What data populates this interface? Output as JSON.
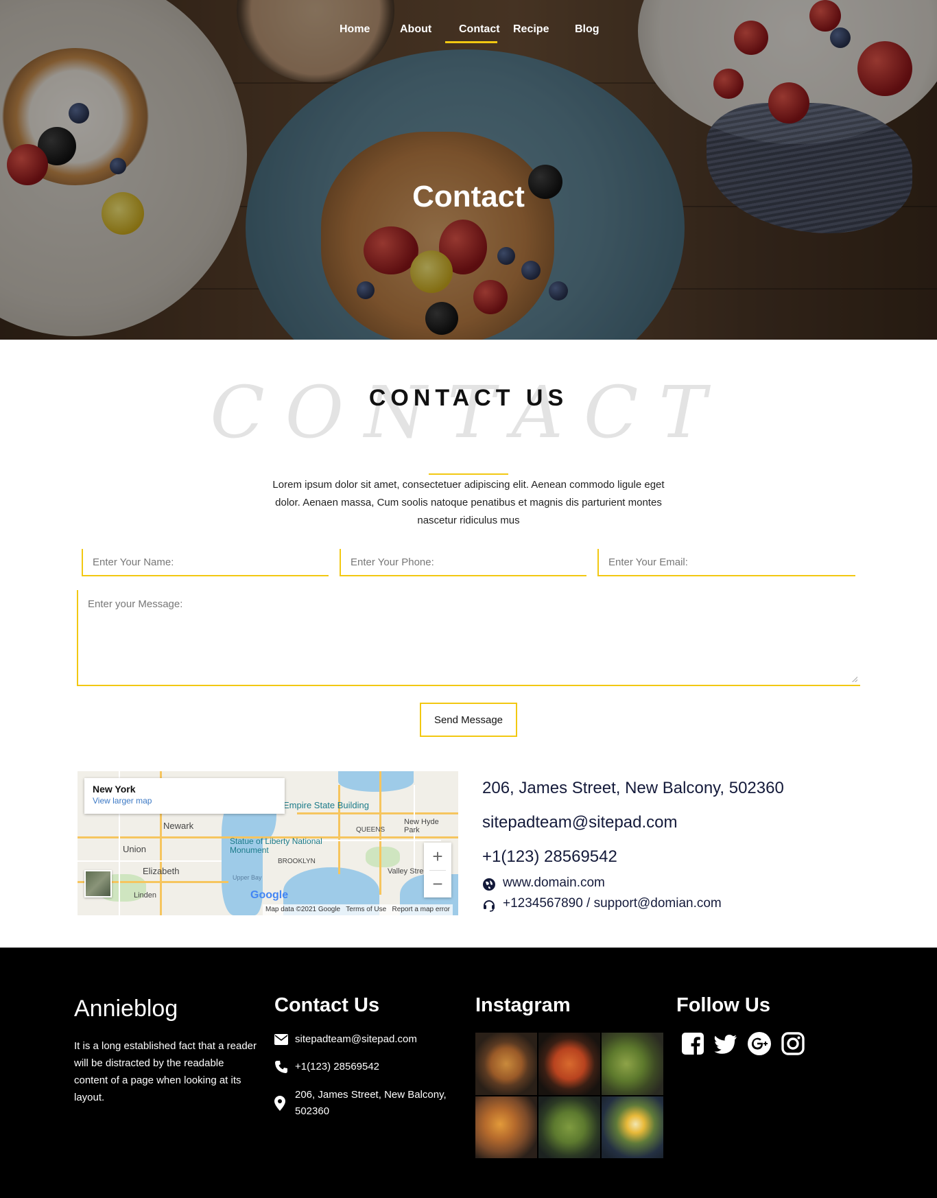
{
  "nav": {
    "items": [
      "Home",
      "About",
      "Contact",
      "Recipe",
      "Blog"
    ],
    "active": "Contact"
  },
  "hero": {
    "title": "Contact"
  },
  "contact_section": {
    "background_word": "CONTACT",
    "title": "CONTACT US",
    "description": "Lorem ipsum dolor sit amet, consectetuer adipiscing elit. Aenean commodo ligule eget dolor. Aenaen massa, Cum soolis natoque penatibus et magnis dis parturient montes nascetur ridiculus mus"
  },
  "form": {
    "name_placeholder": "Enter Your Name:",
    "phone_placeholder": "Enter Your Phone:",
    "email_placeholder": "Enter Your Email:",
    "message_placeholder": "Enter your Message:",
    "submit_label": "Send Message"
  },
  "map": {
    "city": "New York",
    "larger_map_link": "View larger map",
    "labels": [
      "Newark",
      "Union",
      "Elizabeth",
      "Linden",
      "QUEENS",
      "BROOKLYN",
      "New Hyde Park",
      "Valley Stre",
      "Upper Bay"
    ],
    "poi": [
      "Empire State Building",
      "Statue of Liberty National Monument"
    ],
    "attribution": [
      "Map data ©2021 Google",
      "Terms of Use",
      "Report a map error"
    ],
    "logo": "Google",
    "zoom_in": "+",
    "zoom_out": "−"
  },
  "contact_info": {
    "address": "206, James Street, New Balcony, 502360",
    "email": "sitepadteam@sitepad.com",
    "phone": "+1(123) 28569542",
    "website": "www.domain.com",
    "support": "+1234567890 / support@domian.com"
  },
  "footer": {
    "brand": "Annieblog",
    "about": "It is a long established fact that a reader will be distracted by the readable content of a page when looking at its layout.",
    "contact_heading": "Contact Us",
    "email": "sitepadteam@sitepad.com",
    "phone": "+1(123) 28569542",
    "address": "206, James Street, New Balcony, 502360",
    "instagram_heading": "Instagram",
    "follow_heading": "Follow Us",
    "social": [
      "facebook-icon",
      "twitter-icon",
      "google-plus-icon",
      "instagram-icon"
    ]
  },
  "colors": {
    "accent": "#f2c811",
    "footer_bg": "#000000",
    "info_text": "#141a3a"
  }
}
